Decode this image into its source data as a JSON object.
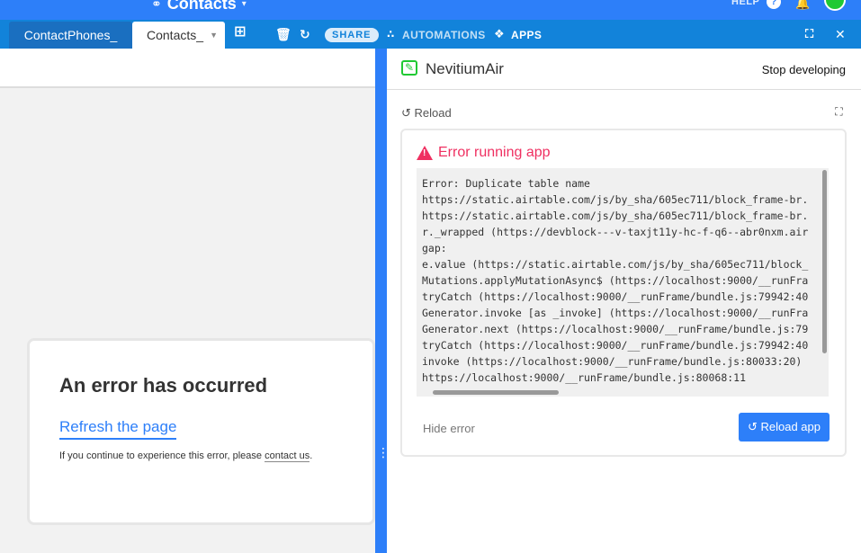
{
  "topbar": {
    "base_title": "Contacts",
    "help_label": "HELP"
  },
  "tabs": [
    {
      "label": "ContactPhones_"
    },
    {
      "label": "Contacts_"
    }
  ],
  "toolbar": {
    "share_label": "SHARE",
    "automations_label": "AUTOMATIONS",
    "apps_label": "APPS"
  },
  "left_error": {
    "title": "An error has occurred",
    "refresh_label": "Refresh the page",
    "note_prefix": "If you continue to experience this error, please ",
    "contact_label": "contact us",
    "note_suffix": "."
  },
  "dev_panel": {
    "app_name": "NevitiumAir",
    "stop_label": "Stop developing",
    "reload_label": "Reload",
    "error_title": "Error running app",
    "stack_trace": "Error: Duplicate table name\nhttps://static.airtable.com/js/by_sha/605ec711/block_frame-br.\nhttps://static.airtable.com/js/by_sha/605ec711/block_frame-br.\nr._wrapped (https://devblock---v-taxjt11y-hc-f-q6--abr0nxm.air\ngap:\ne.value (https://static.airtable.com/js/by_sha/605ec711/block_\nMutations.applyMutationAsync$ (https://localhost:9000/__runFra\ntryCatch (https://localhost:9000/__runFrame/bundle.js:79942:40\nGenerator.invoke [as _invoke] (https://localhost:9000/__runFra\nGenerator.next (https://localhost:9000/__runFrame/bundle.js:79\ntryCatch (https://localhost:9000/__runFrame/bundle.js:79942:40\ninvoke (https://localhost:9000/__runFrame/bundle.js:80033:20)\nhttps://localhost:9000/__runFrame/bundle.js:80068:11",
    "hide_error_label": "Hide error",
    "reload_app_label": "Reload app"
  },
  "colors": {
    "brand_blue": "#2d7ff9",
    "tab_bar_blue": "#1283da",
    "error_red": "#ef3061",
    "app_green": "#20c933"
  }
}
